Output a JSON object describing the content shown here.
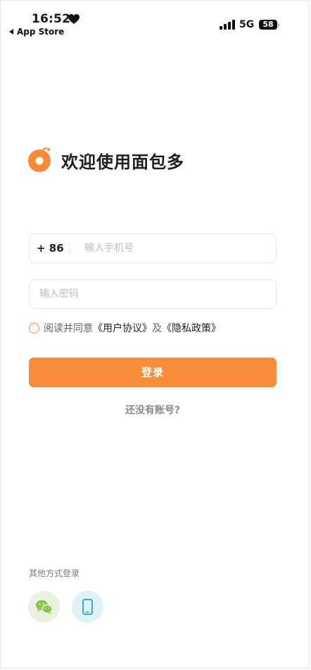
{
  "status_bar": {
    "time": "16:52",
    "back_label": "App Store",
    "network": "5G",
    "battery": "58"
  },
  "brand": {
    "title": "欢迎使用面包多",
    "accent_color": "#fa8d3c"
  },
  "form": {
    "country_code": "+ 86",
    "phone_placeholder": "输入手机号",
    "password_placeholder": "输入密码",
    "agree_text": "阅读并同意",
    "user_agreement": "《用户协议》",
    "and_text": "及",
    "privacy_policy": "《隐私政策》",
    "login_label": "登录",
    "register_link": "还没有账号?"
  },
  "other_login": {
    "label": "其他方式登录",
    "options": [
      {
        "icon": "wechat-icon"
      },
      {
        "icon": "mobile-phone-icon"
      }
    ]
  }
}
